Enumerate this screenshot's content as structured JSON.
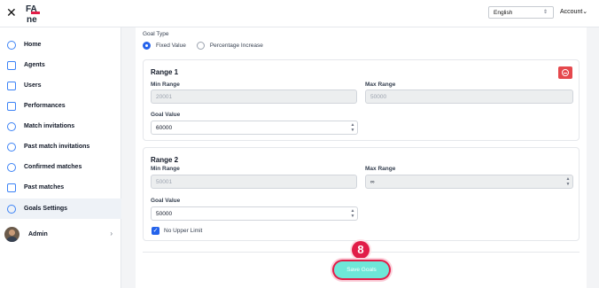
{
  "header": {
    "close_icon": "close-icon",
    "language_value": "English",
    "account_label": "Account"
  },
  "sidebar": {
    "items": [
      {
        "label": "Home",
        "icon": "home-icon"
      },
      {
        "label": "Agents",
        "icon": "user-icon"
      },
      {
        "label": "Users",
        "icon": "user-icon"
      },
      {
        "label": "Performances",
        "icon": "chart-icon"
      },
      {
        "label": "Match invitations",
        "icon": "link-icon"
      },
      {
        "label": "Past match invitations",
        "icon": "link-icon"
      },
      {
        "label": "Confirmed matches",
        "icon": "link-icon"
      },
      {
        "label": "Past matches",
        "icon": "calendar-icon"
      },
      {
        "label": "Goals Settings",
        "icon": "gear-icon"
      }
    ],
    "active_index": 8,
    "admin_label": "Admin"
  },
  "main": {
    "goal_type_label": "Goal Type",
    "options": [
      "Fixed Value",
      "Percentage Increase"
    ],
    "selected_option": "Fixed Value",
    "ranges": [
      {
        "title": "Range 1",
        "min_label": "Min Range",
        "min_value": "20001",
        "max_label": "Max Range",
        "max_value": "50000",
        "goal_label": "Goal Value",
        "goal_value": "60000"
      },
      {
        "title": "Range 2",
        "min_label": "Min Range",
        "min_value": "50001",
        "max_label": "Max Range",
        "max_value": "∞",
        "goal_label": "Goal Value",
        "goal_value": "50000",
        "no_upper_limit_label": "No Upper Limit",
        "no_upper_limit_checked": true
      }
    ],
    "step_number": "8",
    "save_label": "Save Goals"
  },
  "colors": {
    "accent": "#2563eb",
    "danger": "#e5484d",
    "save_button": "#6ee7d8",
    "highlight": "#e11d48"
  }
}
